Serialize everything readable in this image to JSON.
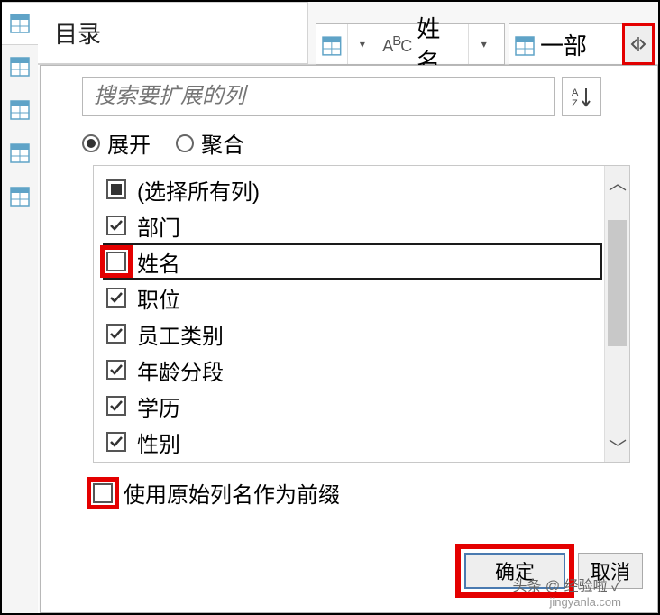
{
  "colors": {
    "highlight": "#e40000"
  },
  "left_tabs": {
    "tab1": "table",
    "tab2": "table",
    "tab3": "table",
    "tab4": "table",
    "tab5": "table"
  },
  "header": {
    "directory_label": "目录",
    "field1_label": "姓名",
    "field2_label": "一部",
    "expand_tooltip": "展开"
  },
  "popup": {
    "search_placeholder": "搜索要扩展的列",
    "sort_tooltip": "排序",
    "radio_expand": "展开",
    "radio_aggregate": "聚合",
    "select_all_label": "(选择所有列)",
    "columns": [
      {
        "label": "部门",
        "checked": true
      },
      {
        "label": "姓名",
        "checked": false,
        "focused": true,
        "highlight": true
      },
      {
        "label": "职位",
        "checked": true
      },
      {
        "label": "员工类别",
        "checked": true
      },
      {
        "label": "年龄分段",
        "checked": true
      },
      {
        "label": "学历",
        "checked": true
      },
      {
        "label": "性别",
        "checked": true
      }
    ],
    "prefix_label": "使用原始列名作为前缀",
    "prefix_checked": false,
    "ok_label": "确定",
    "cancel_label": "取消"
  },
  "watermark": {
    "line1": "头条 @ 经验啦 ✓",
    "line2": "jingyanla.com"
  }
}
